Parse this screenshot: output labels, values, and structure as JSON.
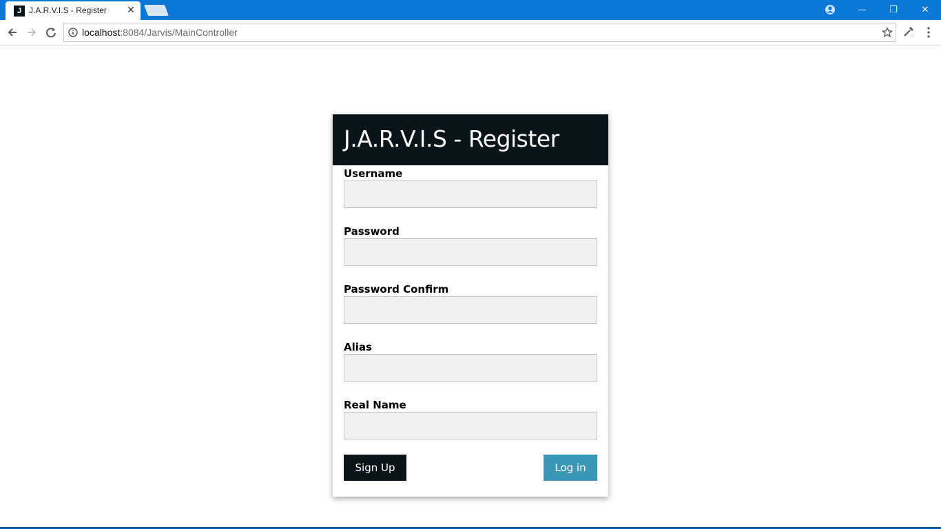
{
  "browser": {
    "tab": {
      "favicon_letter": "J",
      "title": "J.A.R.V.I.S - Register",
      "close_glyph": "✕"
    },
    "window_controls": {
      "minimize": "—",
      "restore": "❐",
      "close": "✕"
    },
    "address": {
      "host": "localhost",
      "rest": ":8084/Jarvis/MainController"
    }
  },
  "form": {
    "title": "J.A.R.V.I.S - Register",
    "fields": [
      {
        "label": "Username",
        "value": ""
      },
      {
        "label": "Password",
        "value": ""
      },
      {
        "label": "Password Confirm",
        "value": ""
      },
      {
        "label": "Alias",
        "value": ""
      },
      {
        "label": "Real Name",
        "value": ""
      }
    ],
    "signup_label": "Sign Up",
    "login_label": "Log in"
  },
  "colors": {
    "titlebar": "#0a78d7",
    "header_dark": "#0b1419",
    "login_button": "#3b97b6",
    "input_bg": "#f1f1f1"
  },
  "icons": {
    "back": "back-arrow-icon",
    "forward": "forward-arrow-icon",
    "reload": "reload-icon",
    "info": "info-icon",
    "bookmark": "star-icon",
    "extension": "eyedropper-icon",
    "menu": "kebab-menu-icon",
    "profile": "profile-icon"
  }
}
